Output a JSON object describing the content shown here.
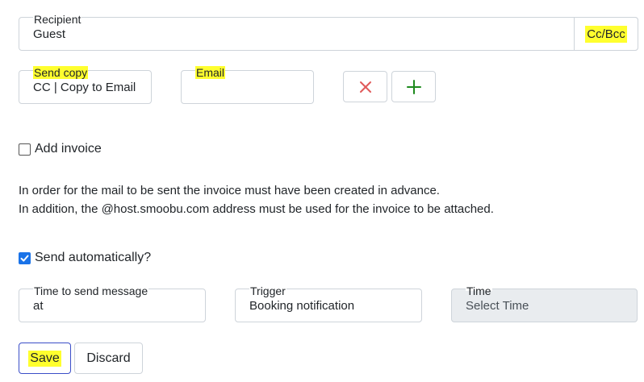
{
  "recipient": {
    "label": "Recipient",
    "value": "Guest",
    "ccbcc_label": "Cc/Bcc"
  },
  "send_copy": {
    "label": "Send copy",
    "value": "CC | Copy to Email"
  },
  "email": {
    "label": "Email",
    "value": ""
  },
  "add_invoice": {
    "label": "Add invoice",
    "checked": false
  },
  "info": {
    "line1": "In order for the mail to be sent the invoice must have been created in advance.",
    "line2": "In addition, the @host.smoobu.com address must be used for the invoice to be attached."
  },
  "send_automatically": {
    "label": "Send automatically?",
    "checked": true
  },
  "time_to_send": {
    "label": "Time to send message",
    "value": "at"
  },
  "trigger": {
    "label": "Trigger",
    "value": "Booking notification"
  },
  "time": {
    "label": "Time",
    "placeholder": "Select Time"
  },
  "actions": {
    "save_label": "Save",
    "discard_label": "Discard"
  },
  "icons": {
    "remove": "close-icon",
    "add": "plus-icon"
  },
  "colors": {
    "highlight": "#ffff2e",
    "remove_icon": "#e05a5a",
    "add_icon": "#1e8a1e",
    "checkbox_checked": "#1a73e8"
  }
}
